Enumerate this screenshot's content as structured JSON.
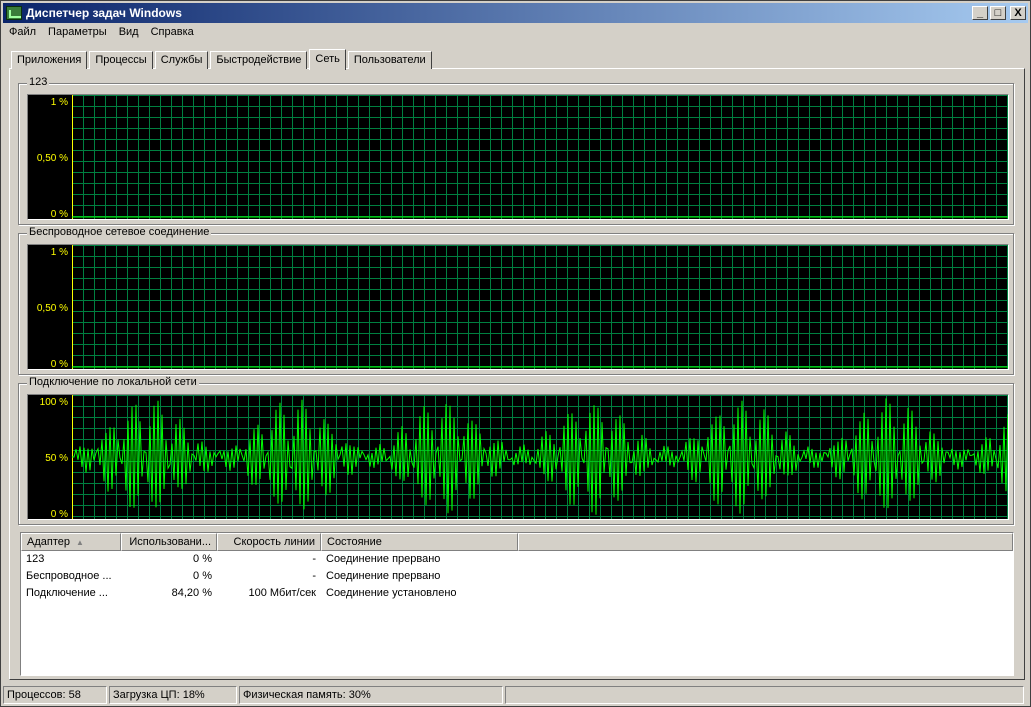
{
  "window": {
    "title": "Диспетчер задач Windows",
    "minimize": "_",
    "maximize": "□",
    "close": "X"
  },
  "menu": [
    "Файл",
    "Параметры",
    "Вид",
    "Справка"
  ],
  "tabs": [
    "Приложения",
    "Процессы",
    "Службы",
    "Быстродействие",
    "Сеть",
    "Пользователи"
  ],
  "active_tab": "Сеть",
  "graphs": [
    {
      "label": "123",
      "y_labels": [
        "1 %",
        "0,50 %",
        "0 %"
      ],
      "usage_pct": 0
    },
    {
      "label": "Беспроводное сетевое соединение",
      "y_labels": [
        "1 %",
        "0,50 %",
        "0 %"
      ],
      "usage_pct": 0
    },
    {
      "label": "Подключение по локальной сети",
      "y_labels": [
        "100 %",
        "50 %",
        "0 %"
      ],
      "usage_pct": 84.2
    }
  ],
  "colors": {
    "graph_bg": "#000000",
    "grid": "#008040",
    "trace": "#00ff00",
    "axis_label": "#ffff00"
  },
  "table": {
    "columns": [
      "Адаптер",
      "Использовани...",
      "Скорость линии",
      "Состояние"
    ],
    "rows": [
      [
        "123",
        "0 %",
        "-",
        "Соединение прервано"
      ],
      [
        "Беспроводное ...",
        "0 %",
        "-",
        "Соединение прервано"
      ],
      [
        "Подключение ...",
        "84,20 %",
        "100 Мбит/сек",
        "Соединение установлено"
      ]
    ]
  },
  "status": {
    "processes": "Процессов: 58",
    "cpu": "Загрузка ЦП: 18%",
    "memory": "Физическая память: 30%"
  }
}
